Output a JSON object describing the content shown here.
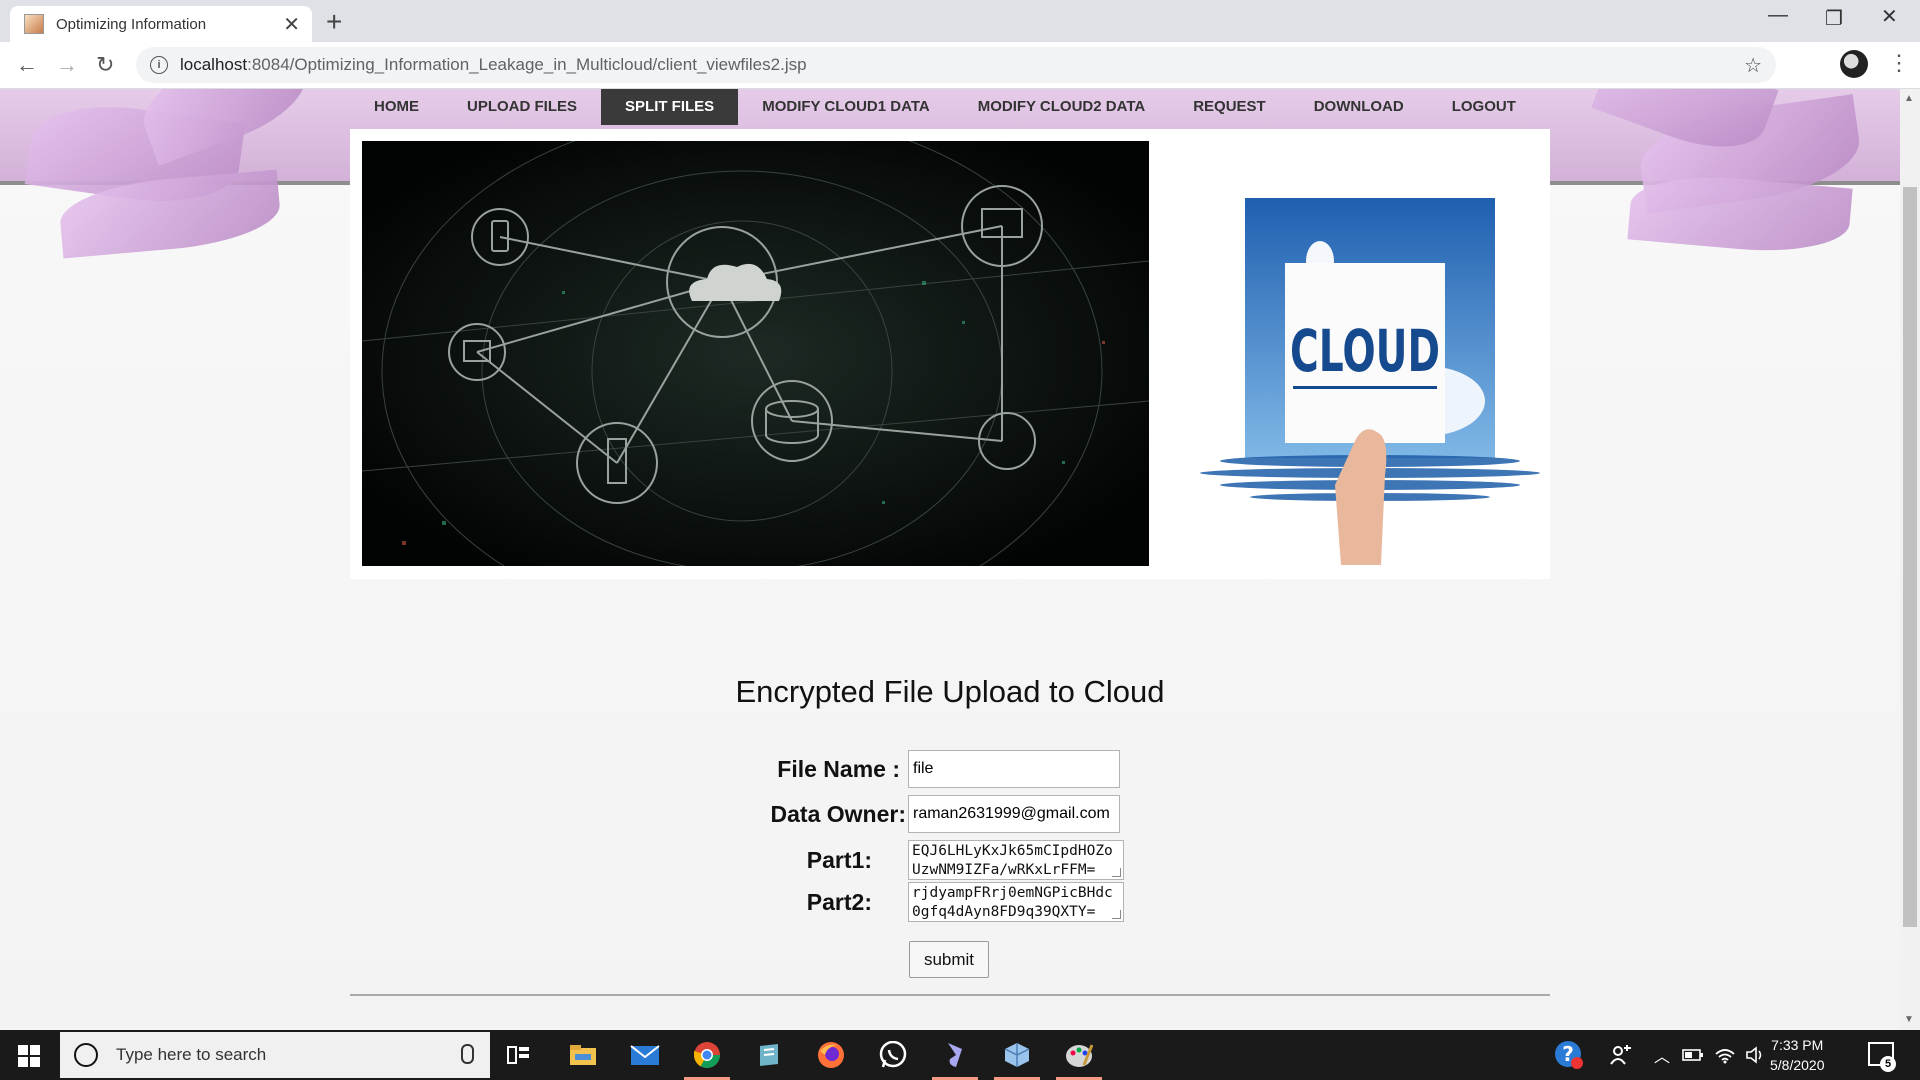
{
  "browser": {
    "tab_title": "Optimizing Information",
    "url_host": "localhost",
    "url_port": ":8084",
    "url_path": "/Optimizing_Information_Leakage_in_Multicloud/client_viewfiles2.jsp"
  },
  "nav": {
    "items": [
      {
        "label": "HOME"
      },
      {
        "label": "UPLOAD FILES"
      },
      {
        "label": "SPLIT FILES",
        "active": true
      },
      {
        "label": "MODIFY CLOUD1 DATA"
      },
      {
        "label": "MODIFY CLOUD2 DATA"
      },
      {
        "label": "REQUEST"
      },
      {
        "label": "DOWNLOAD"
      },
      {
        "label": "LOGOUT"
      }
    ]
  },
  "hero": {
    "card_text": "CLOUD"
  },
  "form": {
    "heading": "Encrypted File Upload to Cloud",
    "file_name_label": "File Name :",
    "file_name_value": "file",
    "data_owner_label": "Data Owner:",
    "data_owner_value": "raman2631999@gmail.com",
    "part1_label": "Part1:",
    "part1_value": "EQJ6LHLyKxJk65mCIpdHOZoUzwNM9IZFa/wRKxLrFFM=",
    "part2_label": "Part2:",
    "part2_value": "rjdyampFRrj0emNGPicBHdc0gfq4dAyn8FD9q39QXTY=",
    "submit_label": "submit"
  },
  "taskbar": {
    "search_placeholder": "Type here to search",
    "time": "7:33 PM",
    "date": "5/8/2020",
    "notification_count": "5"
  },
  "colors": {
    "header_band": "#d9bfdd",
    "nav_active_bg": "#3a3a3a",
    "taskbar_bg": "#1a1a1a"
  }
}
